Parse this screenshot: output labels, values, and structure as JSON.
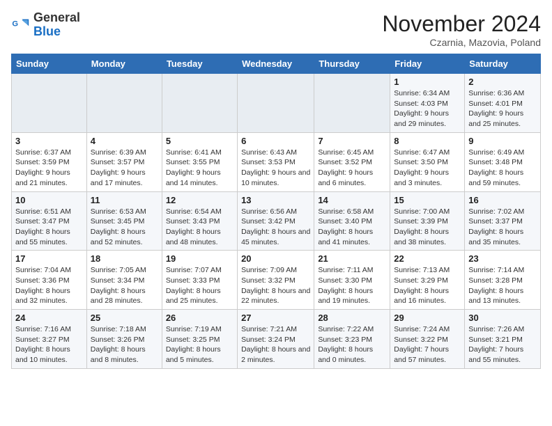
{
  "logo": {
    "text_general": "General",
    "text_blue": "Blue"
  },
  "header": {
    "month": "November 2024",
    "location": "Czarnia, Mazovia, Poland"
  },
  "weekdays": [
    "Sunday",
    "Monday",
    "Tuesday",
    "Wednesday",
    "Thursday",
    "Friday",
    "Saturday"
  ],
  "weeks": [
    [
      {
        "day": "",
        "info": ""
      },
      {
        "day": "",
        "info": ""
      },
      {
        "day": "",
        "info": ""
      },
      {
        "day": "",
        "info": ""
      },
      {
        "day": "",
        "info": ""
      },
      {
        "day": "1",
        "info": "Sunrise: 6:34 AM\nSunset: 4:03 PM\nDaylight: 9 hours and 29 minutes."
      },
      {
        "day": "2",
        "info": "Sunrise: 6:36 AM\nSunset: 4:01 PM\nDaylight: 9 hours and 25 minutes."
      }
    ],
    [
      {
        "day": "3",
        "info": "Sunrise: 6:37 AM\nSunset: 3:59 PM\nDaylight: 9 hours and 21 minutes."
      },
      {
        "day": "4",
        "info": "Sunrise: 6:39 AM\nSunset: 3:57 PM\nDaylight: 9 hours and 17 minutes."
      },
      {
        "day": "5",
        "info": "Sunrise: 6:41 AM\nSunset: 3:55 PM\nDaylight: 9 hours and 14 minutes."
      },
      {
        "day": "6",
        "info": "Sunrise: 6:43 AM\nSunset: 3:53 PM\nDaylight: 9 hours and 10 minutes."
      },
      {
        "day": "7",
        "info": "Sunrise: 6:45 AM\nSunset: 3:52 PM\nDaylight: 9 hours and 6 minutes."
      },
      {
        "day": "8",
        "info": "Sunrise: 6:47 AM\nSunset: 3:50 PM\nDaylight: 9 hours and 3 minutes."
      },
      {
        "day": "9",
        "info": "Sunrise: 6:49 AM\nSunset: 3:48 PM\nDaylight: 8 hours and 59 minutes."
      }
    ],
    [
      {
        "day": "10",
        "info": "Sunrise: 6:51 AM\nSunset: 3:47 PM\nDaylight: 8 hours and 55 minutes."
      },
      {
        "day": "11",
        "info": "Sunrise: 6:53 AM\nSunset: 3:45 PM\nDaylight: 8 hours and 52 minutes."
      },
      {
        "day": "12",
        "info": "Sunrise: 6:54 AM\nSunset: 3:43 PM\nDaylight: 8 hours and 48 minutes."
      },
      {
        "day": "13",
        "info": "Sunrise: 6:56 AM\nSunset: 3:42 PM\nDaylight: 8 hours and 45 minutes."
      },
      {
        "day": "14",
        "info": "Sunrise: 6:58 AM\nSunset: 3:40 PM\nDaylight: 8 hours and 41 minutes."
      },
      {
        "day": "15",
        "info": "Sunrise: 7:00 AM\nSunset: 3:39 PM\nDaylight: 8 hours and 38 minutes."
      },
      {
        "day": "16",
        "info": "Sunrise: 7:02 AM\nSunset: 3:37 PM\nDaylight: 8 hours and 35 minutes."
      }
    ],
    [
      {
        "day": "17",
        "info": "Sunrise: 7:04 AM\nSunset: 3:36 PM\nDaylight: 8 hours and 32 minutes."
      },
      {
        "day": "18",
        "info": "Sunrise: 7:05 AM\nSunset: 3:34 PM\nDaylight: 8 hours and 28 minutes."
      },
      {
        "day": "19",
        "info": "Sunrise: 7:07 AM\nSunset: 3:33 PM\nDaylight: 8 hours and 25 minutes."
      },
      {
        "day": "20",
        "info": "Sunrise: 7:09 AM\nSunset: 3:32 PM\nDaylight: 8 hours and 22 minutes."
      },
      {
        "day": "21",
        "info": "Sunrise: 7:11 AM\nSunset: 3:30 PM\nDaylight: 8 hours and 19 minutes."
      },
      {
        "day": "22",
        "info": "Sunrise: 7:13 AM\nSunset: 3:29 PM\nDaylight: 8 hours and 16 minutes."
      },
      {
        "day": "23",
        "info": "Sunrise: 7:14 AM\nSunset: 3:28 PM\nDaylight: 8 hours and 13 minutes."
      }
    ],
    [
      {
        "day": "24",
        "info": "Sunrise: 7:16 AM\nSunset: 3:27 PM\nDaylight: 8 hours and 10 minutes."
      },
      {
        "day": "25",
        "info": "Sunrise: 7:18 AM\nSunset: 3:26 PM\nDaylight: 8 hours and 8 minutes."
      },
      {
        "day": "26",
        "info": "Sunrise: 7:19 AM\nSunset: 3:25 PM\nDaylight: 8 hours and 5 minutes."
      },
      {
        "day": "27",
        "info": "Sunrise: 7:21 AM\nSunset: 3:24 PM\nDaylight: 8 hours and 2 minutes."
      },
      {
        "day": "28",
        "info": "Sunrise: 7:22 AM\nSunset: 3:23 PM\nDaylight: 8 hours and 0 minutes."
      },
      {
        "day": "29",
        "info": "Sunrise: 7:24 AM\nSunset: 3:22 PM\nDaylight: 7 hours and 57 minutes."
      },
      {
        "day": "30",
        "info": "Sunrise: 7:26 AM\nSunset: 3:21 PM\nDaylight: 7 hours and 55 minutes."
      }
    ]
  ]
}
